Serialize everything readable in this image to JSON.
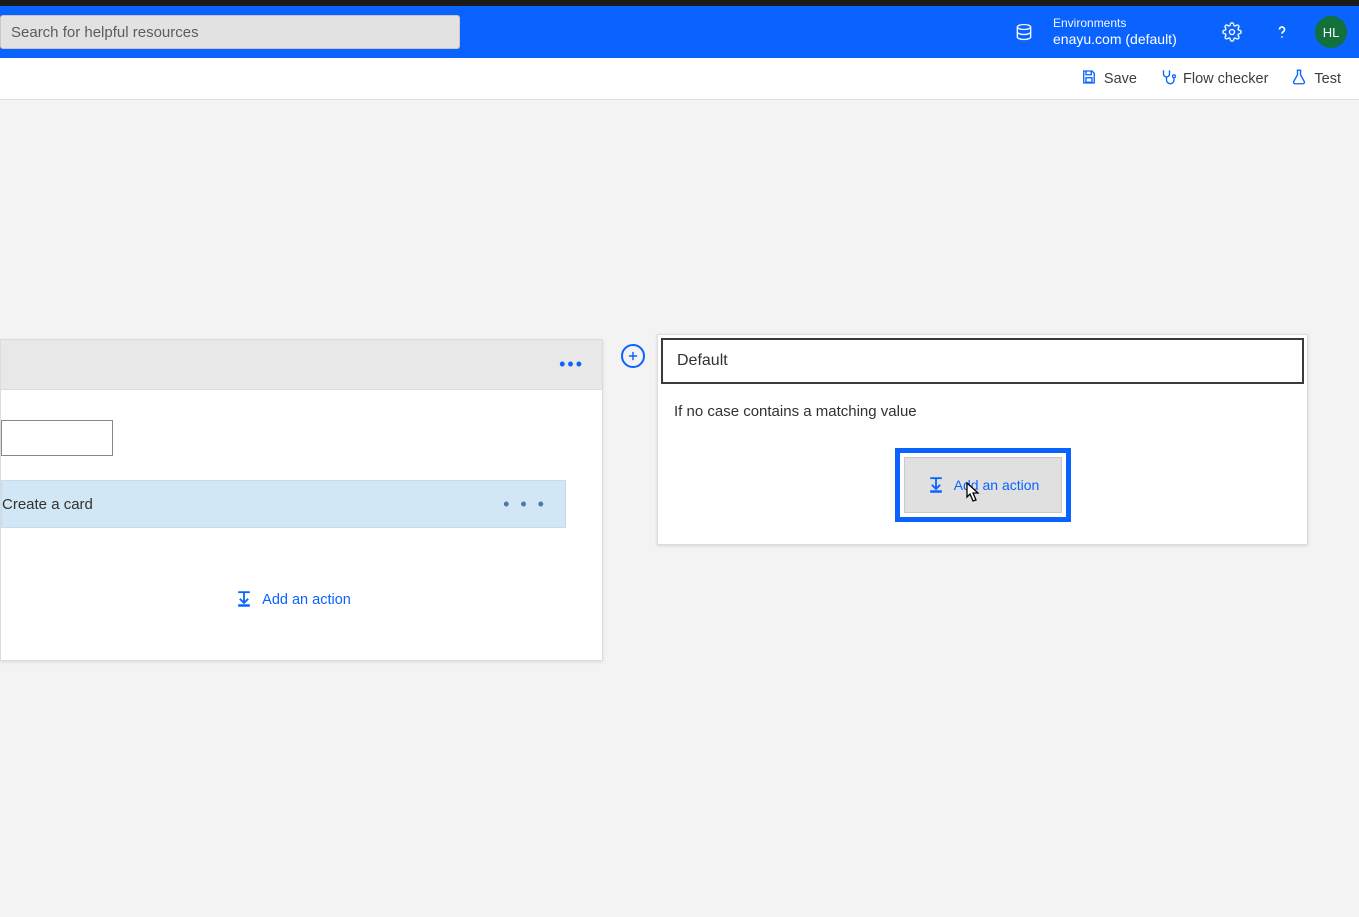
{
  "search": {
    "placeholder": "Search for helpful resources"
  },
  "env": {
    "label": "Environments",
    "name": "enayu.com (default)"
  },
  "avatar": {
    "initials": "HL"
  },
  "toolbar": {
    "save": "Save",
    "flowchecker": "Flow checker",
    "test": "Test"
  },
  "caseCard": {
    "actionLabel": "Create a card",
    "addAction": "Add an action"
  },
  "defaultCard": {
    "title": "Default",
    "desc": "If no case contains a matching value",
    "addAction": "Add an action"
  }
}
